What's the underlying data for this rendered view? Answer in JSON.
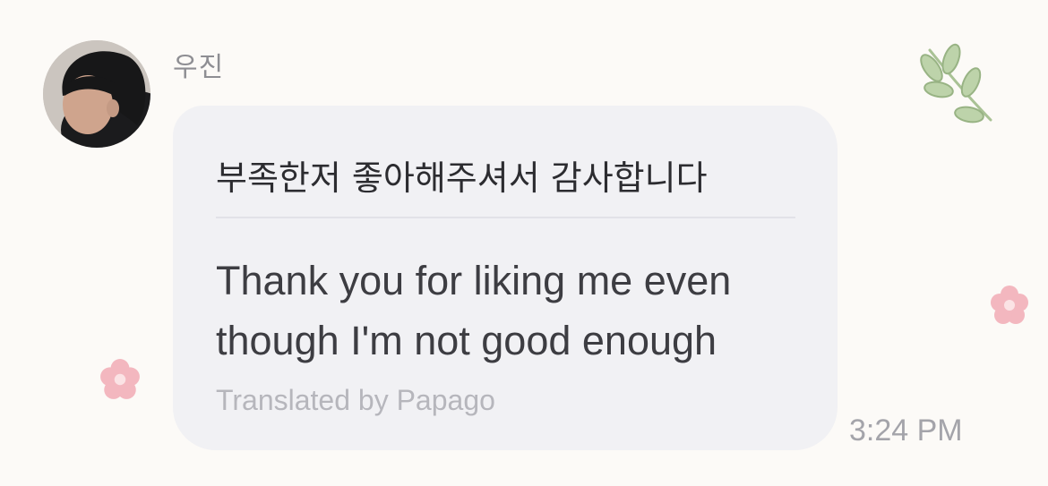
{
  "message": {
    "sender_name": "우진",
    "original_text": "부족한저 좋아해주셔서 감사합니다",
    "translated_text": "Thank you for liking me even though I'm not good enough",
    "attribution": "Translated by Papago",
    "time": "3:24 PM"
  },
  "icons": {
    "avatar": "profile-photo",
    "decor_leaf": "leaf-sprig-icon",
    "decor_flower_left": "flower-icon",
    "decor_flower_right": "flower-icon"
  },
  "colors": {
    "background": "#fcfaf7",
    "bubble": "#f1f1f4",
    "message_text": "#2c2c30",
    "muted_text": "#a4a4aa",
    "flower": "#f3b7bf",
    "leaf": "#b7cfa4"
  }
}
